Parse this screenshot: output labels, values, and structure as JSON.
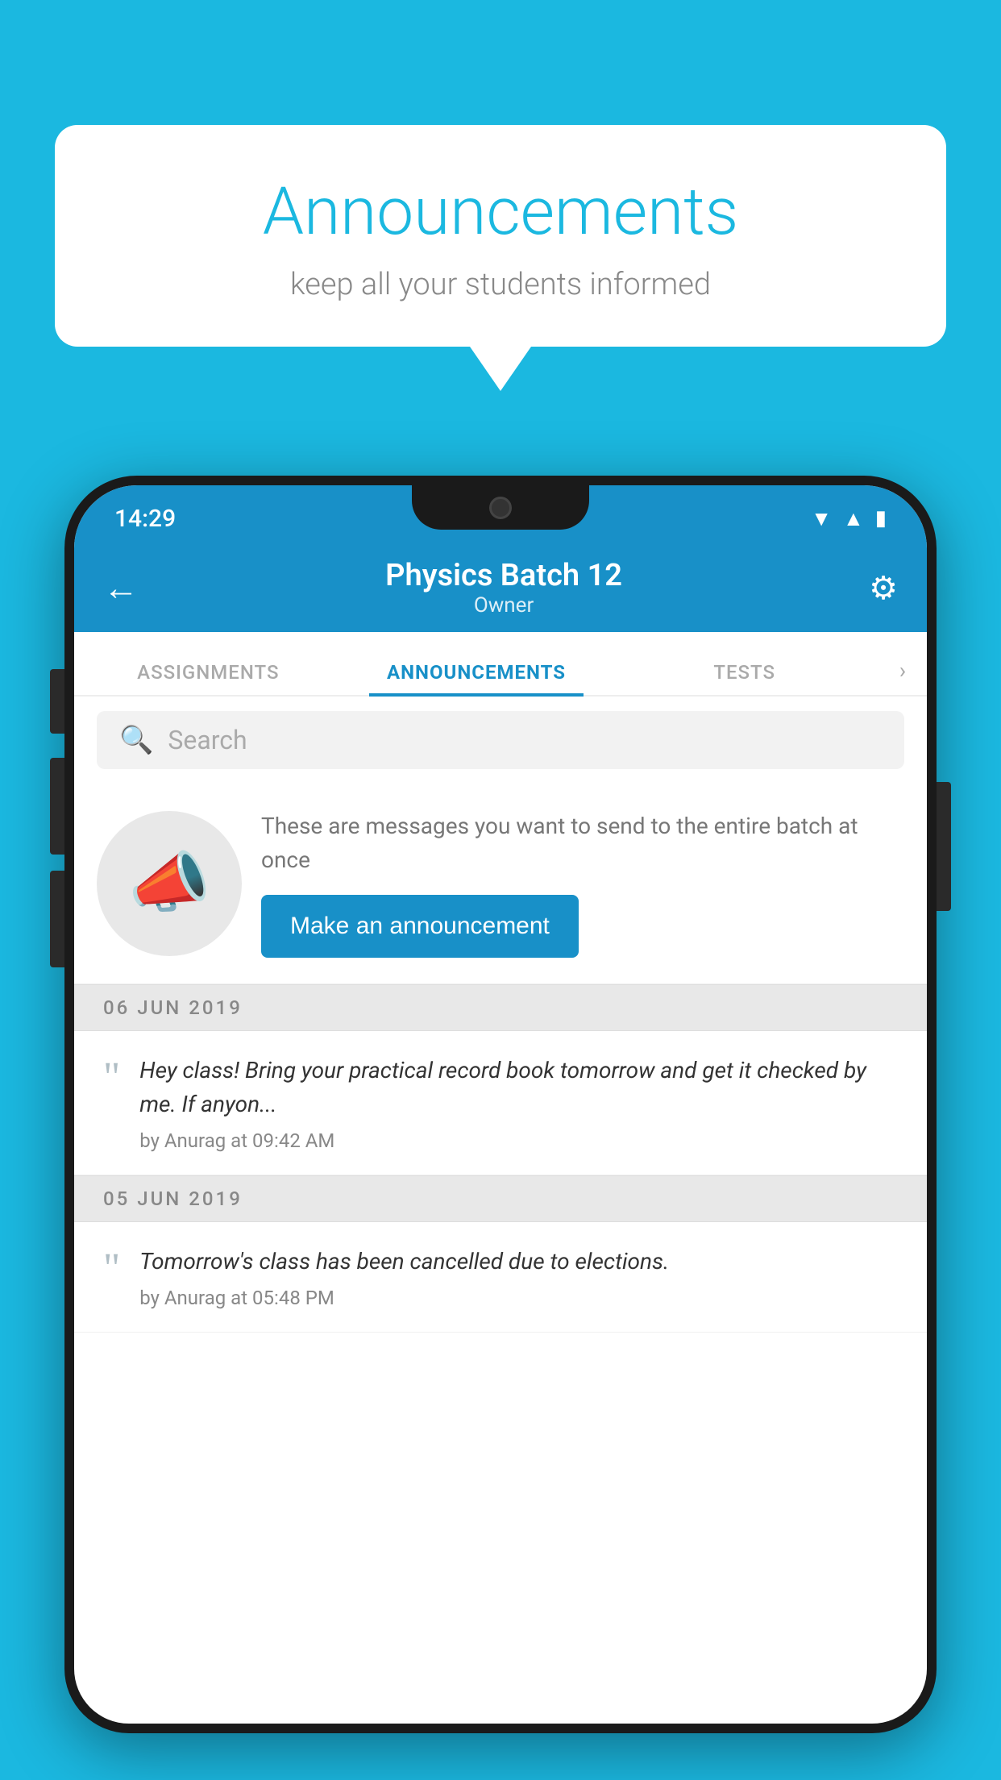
{
  "bubble": {
    "title": "Announcements",
    "subtitle": "keep all your students informed"
  },
  "statusBar": {
    "time": "14:29",
    "icons": [
      "wifi",
      "signal",
      "battery"
    ]
  },
  "header": {
    "title": "Physics Batch 12",
    "subtitle": "Owner",
    "backLabel": "←"
  },
  "tabs": [
    {
      "label": "ASSIGNMENTS",
      "active": false
    },
    {
      "label": "ANNOUNCEMENTS",
      "active": true
    },
    {
      "label": "TESTS",
      "active": false
    }
  ],
  "search": {
    "placeholder": "Search"
  },
  "announcementPrompt": {
    "message": "These are messages you want to send to the entire batch at once",
    "buttonLabel": "Make an announcement"
  },
  "dateSeparators": [
    {
      "label": "06  JUN  2019"
    },
    {
      "label": "05  JUN  2019"
    }
  ],
  "announcements": [
    {
      "text": "Hey class! Bring your practical record book tomorrow and get it checked by me. If anyon...",
      "meta": "by Anurag at 09:42 AM"
    },
    {
      "text": "Tomorrow's class has been cancelled due to elections.",
      "meta": "by Anurag at 05:48 PM"
    }
  ],
  "colors": {
    "brand": "#1890c8",
    "background": "#1bb8e0",
    "headerBg": "#1890c8"
  }
}
